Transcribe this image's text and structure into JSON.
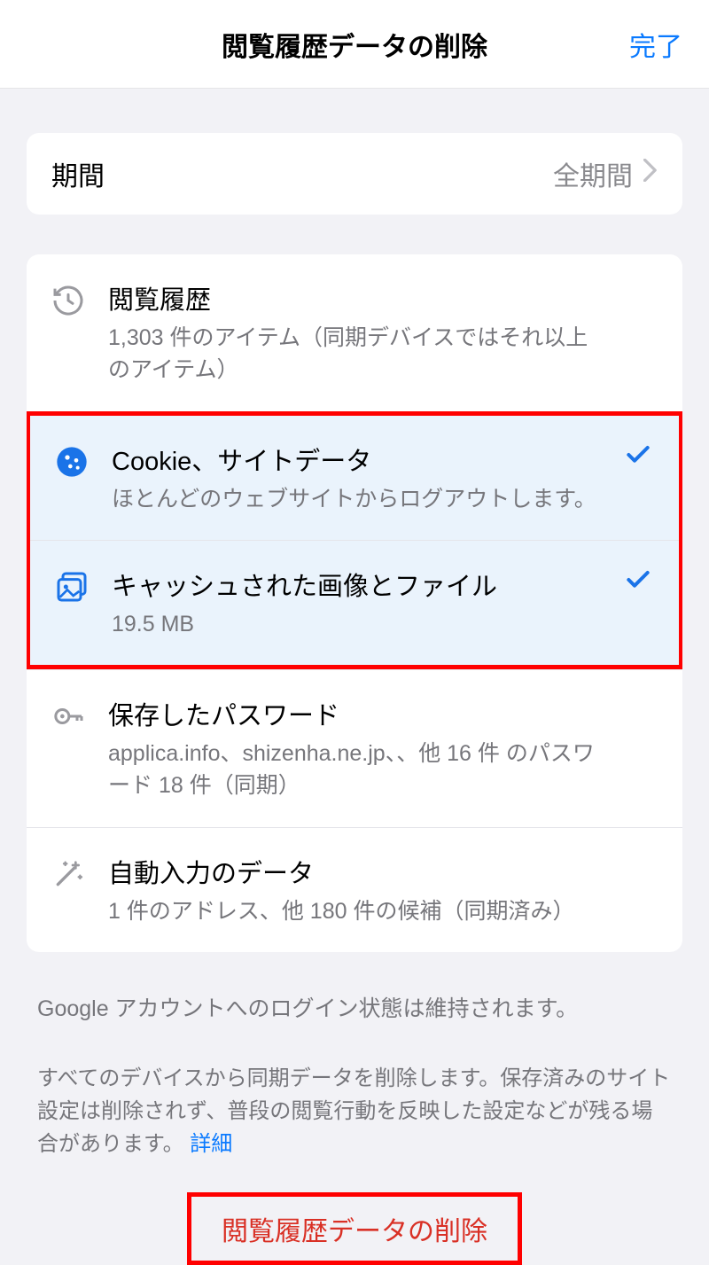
{
  "header": {
    "title": "閲覧履歴データの削除",
    "done": "完了"
  },
  "period": {
    "label": "期間",
    "value": "全期間"
  },
  "items": {
    "history": {
      "title": "閲覧履歴",
      "sub": "1,303 件のアイテム（同期デバイスではそれ以上のアイテム）"
    },
    "cookies": {
      "title": "Cookie、サイトデータ",
      "sub": "ほとんどのウェブサイトからログアウトします。"
    },
    "cache": {
      "title": "キャッシュされた画像とファイル",
      "sub": "19.5 MB"
    },
    "passwords": {
      "title": "保存したパスワード",
      "sub": "applica.info、shizenha.ne.jp、、他 16 件 のパスワード 18 件（同期）"
    },
    "autofill": {
      "title": "自動入力のデータ",
      "sub": "1 件のアドレス、他 180 件の候補（同期済み）"
    }
  },
  "notes": {
    "note1": "Google アカウントへのログイン状態は維持されます。",
    "note2_a": "すべてのデバイスから同期データを削除します。保存済みのサイト設定は削除されず、普段の閲覧行動を反映した設定などが残る場合があります。",
    "note2_link": "詳細"
  },
  "clear_button": "閲覧履歴データの削除"
}
